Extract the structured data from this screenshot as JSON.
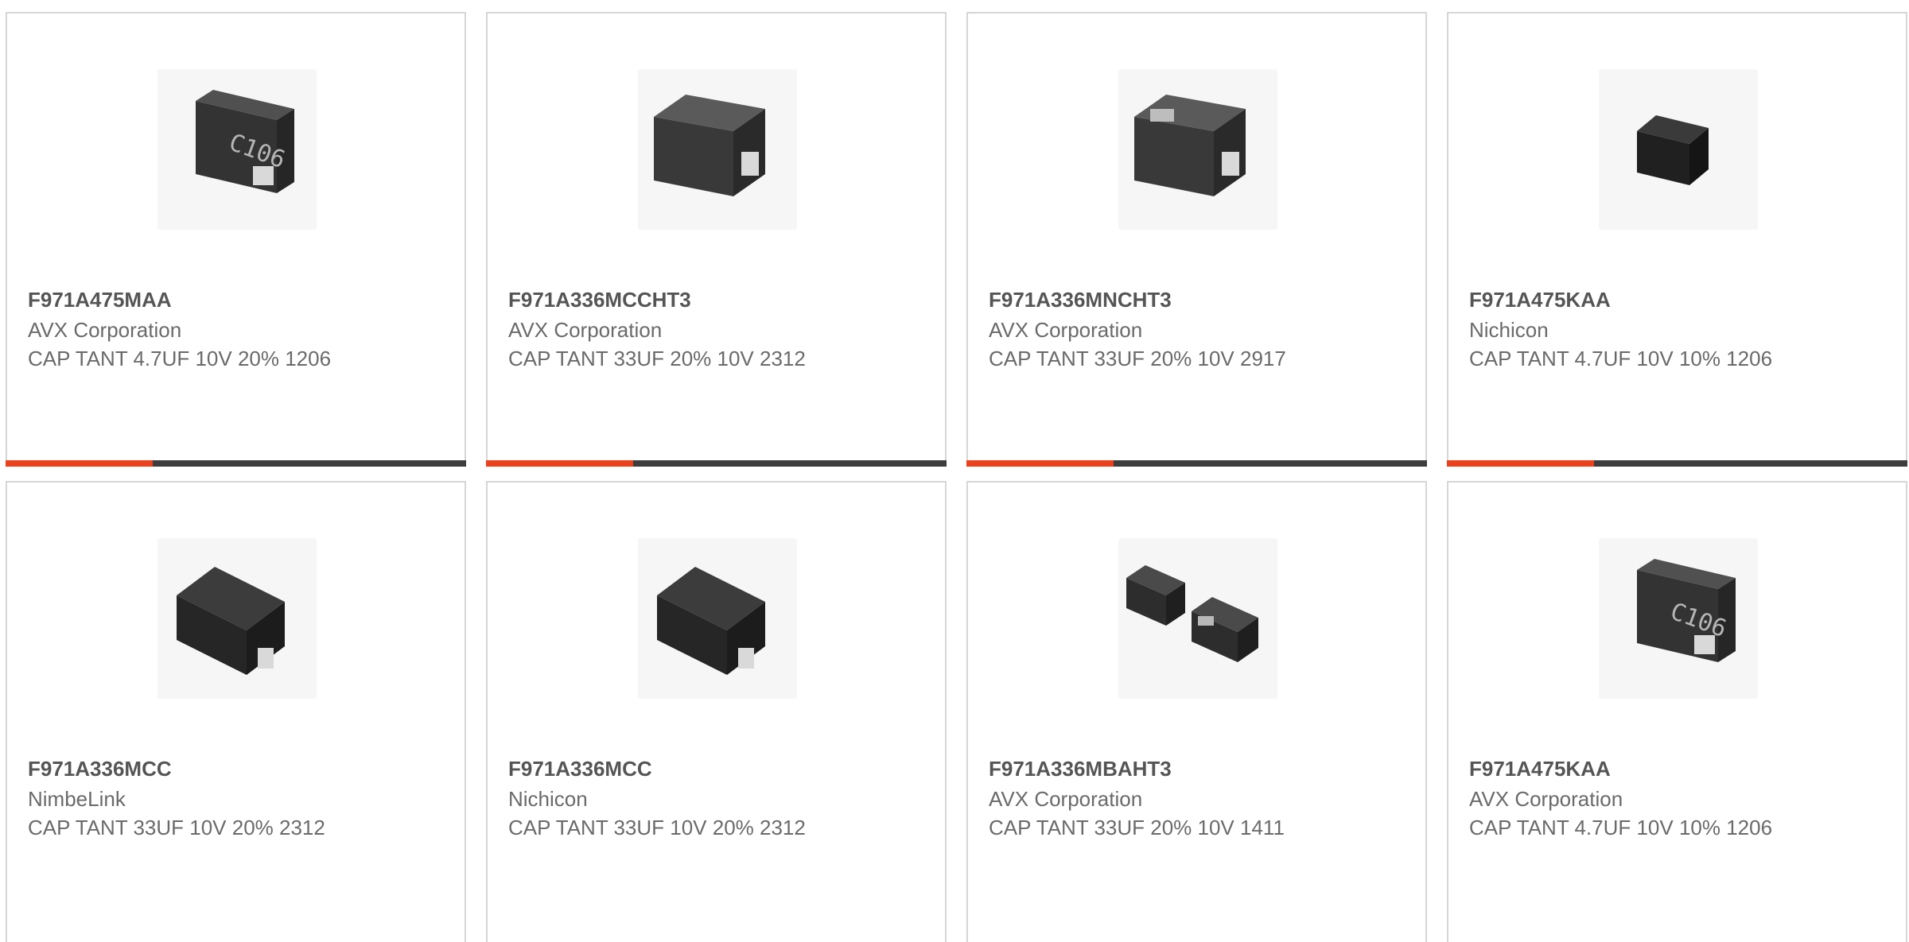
{
  "colors": {
    "accent": "#e9421c",
    "bar_dark": "#3d3d3d",
    "card_border": "#d6d6d6",
    "text_bold": "#555555",
    "text": "#6a6a6a"
  },
  "cards": [
    {
      "part": "F971A475MAA",
      "manufacturer": "AVX Corporation",
      "description": "CAP TANT 4.7UF 10V 20% 1206",
      "image": "capacitor-c106-icon",
      "progress": 0.32
    },
    {
      "part": "F971A336MCCHT3",
      "manufacturer": "AVX Corporation",
      "description": "CAP TANT 33UF 20% 10V 2312",
      "image": "capacitor-icon",
      "progress": 0.32
    },
    {
      "part": "F971A336MNCHT3",
      "manufacturer": "AVX Corporation",
      "description": "CAP TANT 33UF 20% 10V 2917",
      "image": "capacitor-icon",
      "progress": 0.32
    },
    {
      "part": "F971A475KAA",
      "manufacturer": "Nichicon",
      "description": "CAP TANT 4.7UF 10V 10% 1206",
      "image": "capacitor-small-icon",
      "progress": 0.32
    },
    {
      "part": "F971A336MCC",
      "manufacturer": "NimbeLink",
      "description": "CAP TANT 33UF 10V 20% 2312",
      "image": "capacitor-icon"
    },
    {
      "part": "F971A336MCC",
      "manufacturer": "Nichicon",
      "description": "CAP TANT 33UF 10V 20% 2312",
      "image": "capacitor-icon"
    },
    {
      "part": "F971A336MBAHT3",
      "manufacturer": "AVX Corporation",
      "description": "CAP TANT 33UF 20% 10V 1411",
      "image": "capacitor-pair-icon"
    },
    {
      "part": "F971A475KAA",
      "manufacturer": "AVX Corporation",
      "description": "CAP TANT 4.7UF 10V 10% 1206",
      "image": "capacitor-c106-icon"
    }
  ]
}
